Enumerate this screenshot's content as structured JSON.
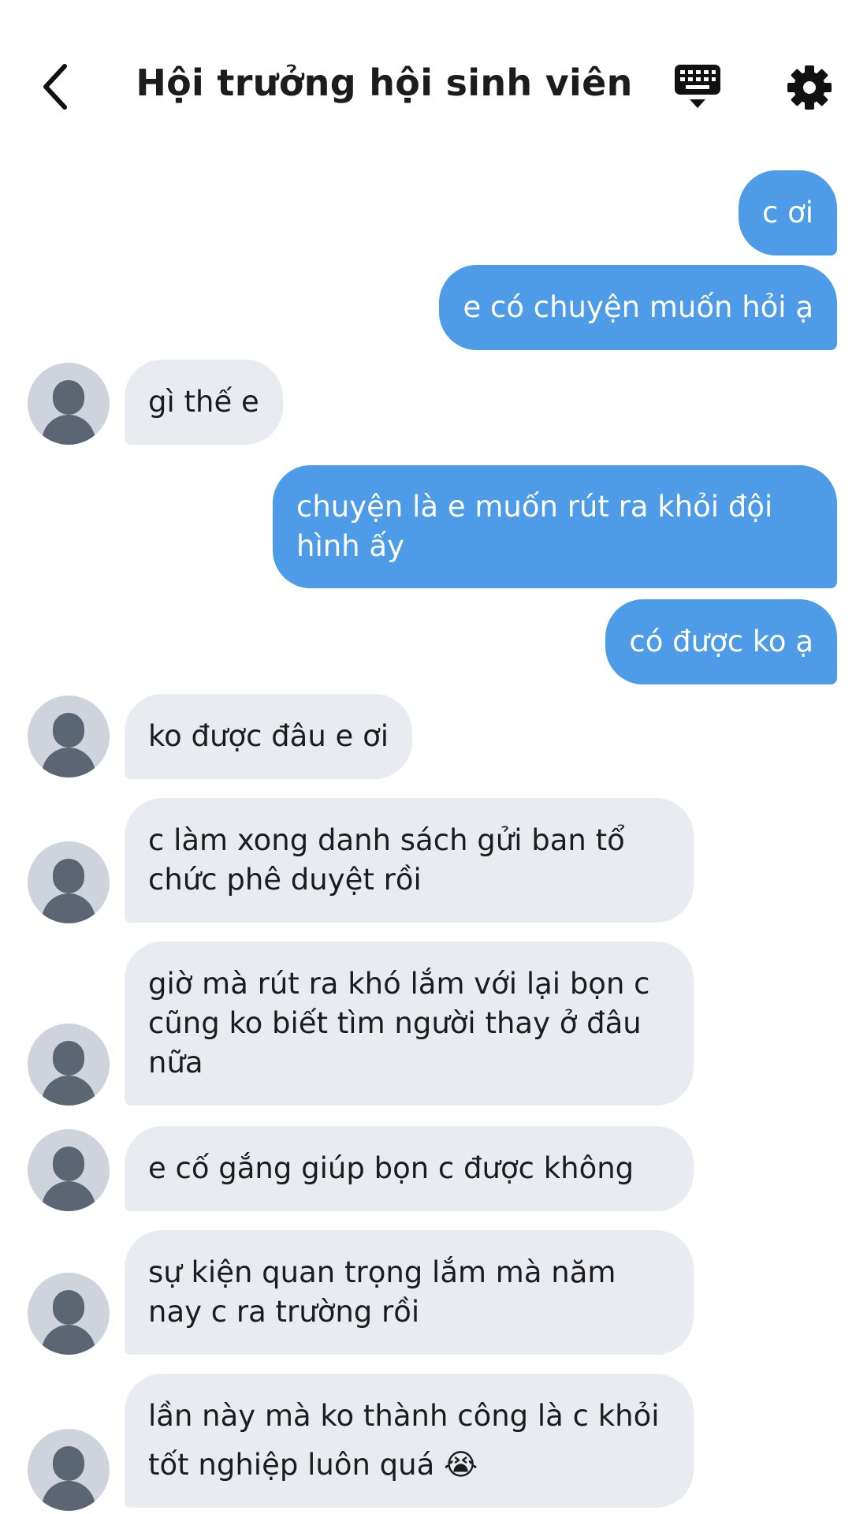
{
  "header": {
    "title": "Hội trưởng hội sinh viên",
    "back_icon": "chevron-left-icon",
    "keyboard_icon": "keyboard-icon",
    "settings_icon": "gear-icon"
  },
  "colors": {
    "outgoing_bubble": "#4e9be8",
    "incoming_bubble": "#e8ebf0",
    "avatar_bg": "#cfd4dc",
    "avatar_fg": "#5c6673"
  },
  "messages": [
    {
      "from": "me",
      "text": "c ơi"
    },
    {
      "from": "me",
      "text": "e có chuyện muốn hỏi ạ"
    },
    {
      "from": "them",
      "text": "gì thế e"
    },
    {
      "from": "me",
      "text": "chuyện là e muốn rút ra khỏi đội hình ấy"
    },
    {
      "from": "me",
      "text": "có được ko ạ"
    },
    {
      "from": "them",
      "text": "ko được đâu e ơi"
    },
    {
      "from": "them",
      "text": "c làm xong danh sách gửi ban tổ chức phê duyệt rồi"
    },
    {
      "from": "them",
      "text": "giờ mà rút ra khó lắm với lại bọn c cũng ko biết tìm người thay ở đâu nữa"
    },
    {
      "from": "them",
      "text": "e cố gắng giúp bọn c được không"
    },
    {
      "from": "them",
      "text": "sự kiện quan trọng lắm mà năm nay c ra trường rồi"
    },
    {
      "from": "them",
      "text": "lần này mà ko thành công là c khỏi tốt nghiệp luôn quá 😭"
    }
  ]
}
